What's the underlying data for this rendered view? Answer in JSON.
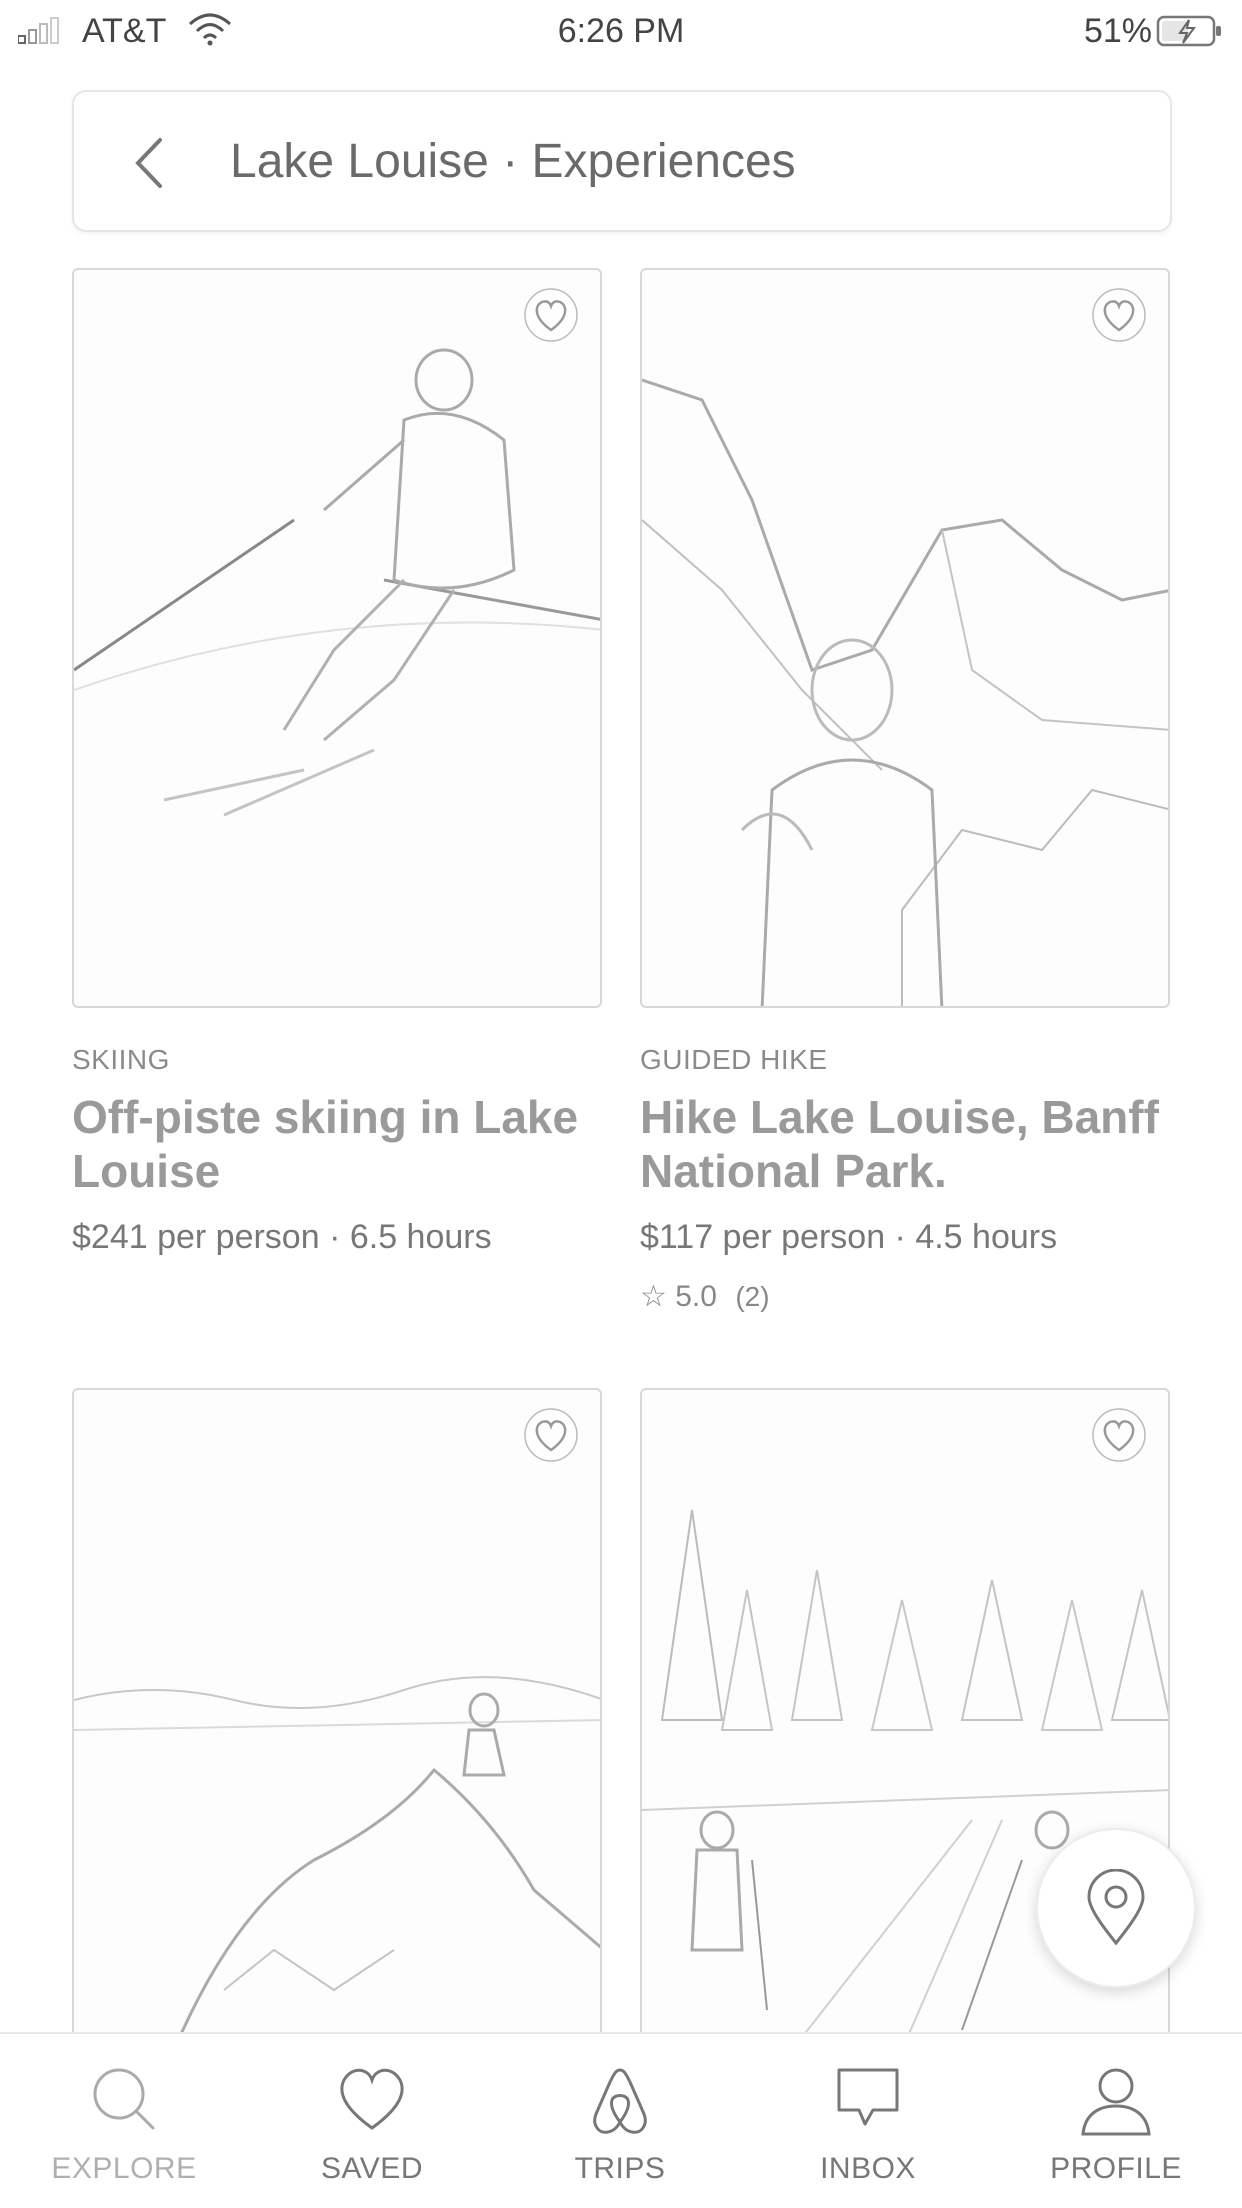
{
  "status_bar": {
    "carrier": "AT&T",
    "time": "6:26 PM",
    "battery_percent": "51%"
  },
  "header": {
    "title": "Lake Louise · Experiences"
  },
  "experiences": [
    {
      "category": "SKIING",
      "title": "Off-piste skiing in Lake Louise",
      "meta": "$241 per person · 6.5 hours",
      "image": "skier-photo"
    },
    {
      "category": "GUIDED HIKE",
      "title": "Hike Lake Louise, Banff National Park.",
      "meta": "$117 per person · 4.5 hours",
      "rating": "5.0",
      "review_count": "(2)",
      "image": "hiker-mountain-photo"
    },
    {
      "image": "person-on-cliff-photo"
    },
    {
      "image": "forest-skiers-photo"
    }
  ],
  "tabs": [
    {
      "label": "EXPLORE",
      "icon": "search-icon",
      "active": true
    },
    {
      "label": "SAVED",
      "icon": "heart-icon"
    },
    {
      "label": "TRIPS",
      "icon": "airbnb-logo-icon"
    },
    {
      "label": "INBOX",
      "icon": "chat-bubble-icon"
    },
    {
      "label": "PROFILE",
      "icon": "person-icon"
    }
  ],
  "map_button": {
    "icon": "map-pin-icon"
  }
}
